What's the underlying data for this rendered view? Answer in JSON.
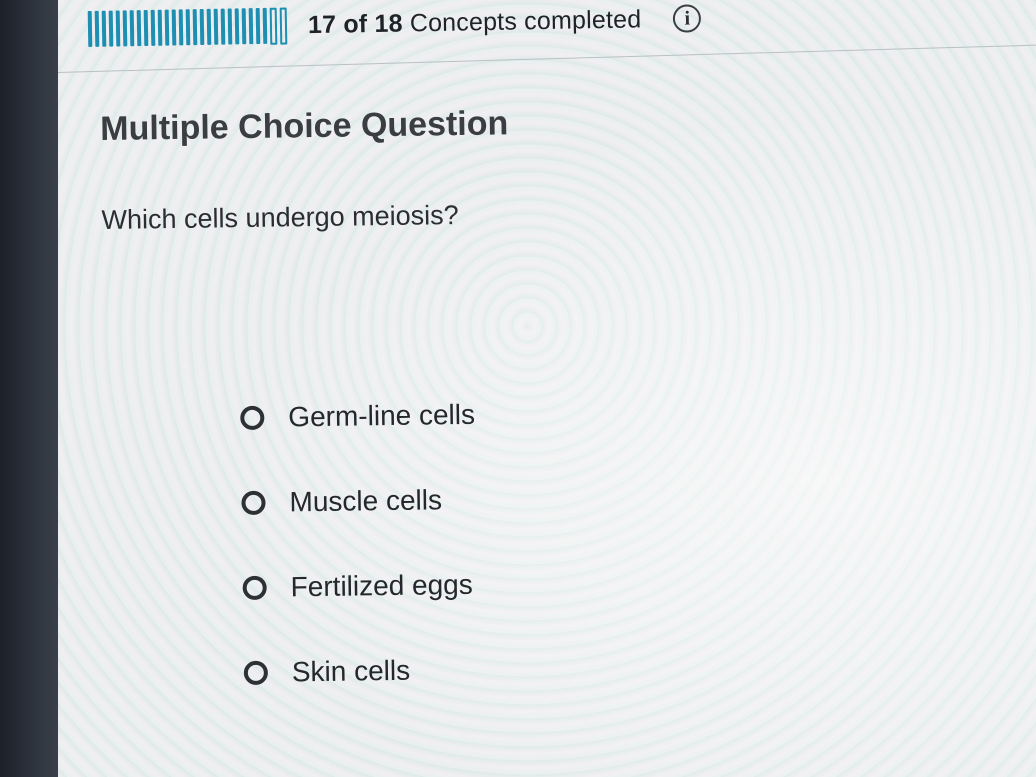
{
  "progress": {
    "completed": "17 of 18",
    "suffix": "Concepts completed",
    "fraction": 0.944,
    "info_icon": "info-icon"
  },
  "question": {
    "type_heading": "Multiple Choice Question",
    "prompt": "Which cells undergo meiosis?"
  },
  "options": [
    {
      "label": "Germ-line cells",
      "selected": false
    },
    {
      "label": "Muscle cells",
      "selected": false
    },
    {
      "label": "Fertilized eggs",
      "selected": false
    },
    {
      "label": "Skin cells",
      "selected": false
    }
  ],
  "colors": {
    "progress_accent": "#1e8fb2",
    "text": "#2a2d31"
  }
}
